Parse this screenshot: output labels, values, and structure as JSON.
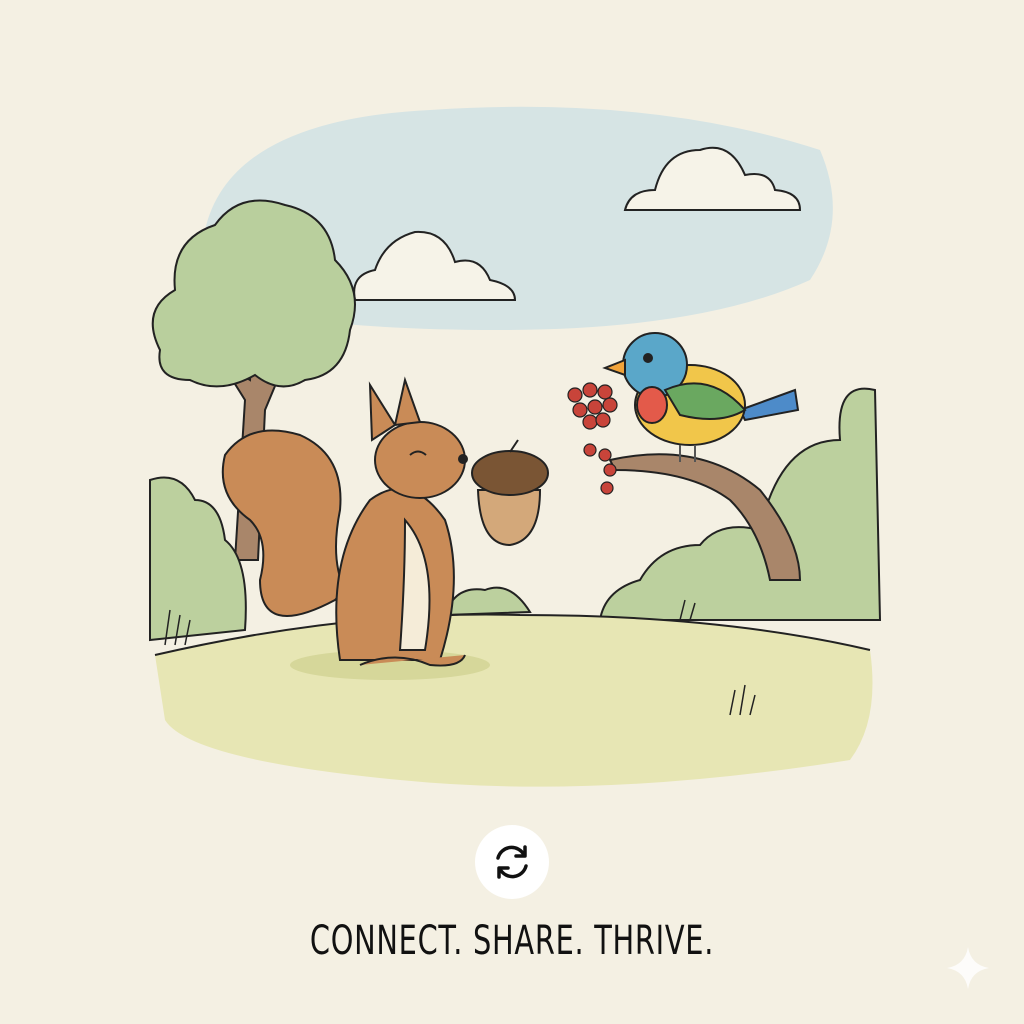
{
  "tagline": "CONNECT. SHARE. THRIVE.",
  "icons": {
    "refresh": "refresh-icon",
    "sparkle": "sparkle-icon"
  },
  "colors": {
    "background": "#f4f0e3",
    "sky": "#d6e4e4",
    "ground": "#e7e6b4",
    "squirrel": "#c98b57",
    "foliage": "#b9cf9d"
  }
}
